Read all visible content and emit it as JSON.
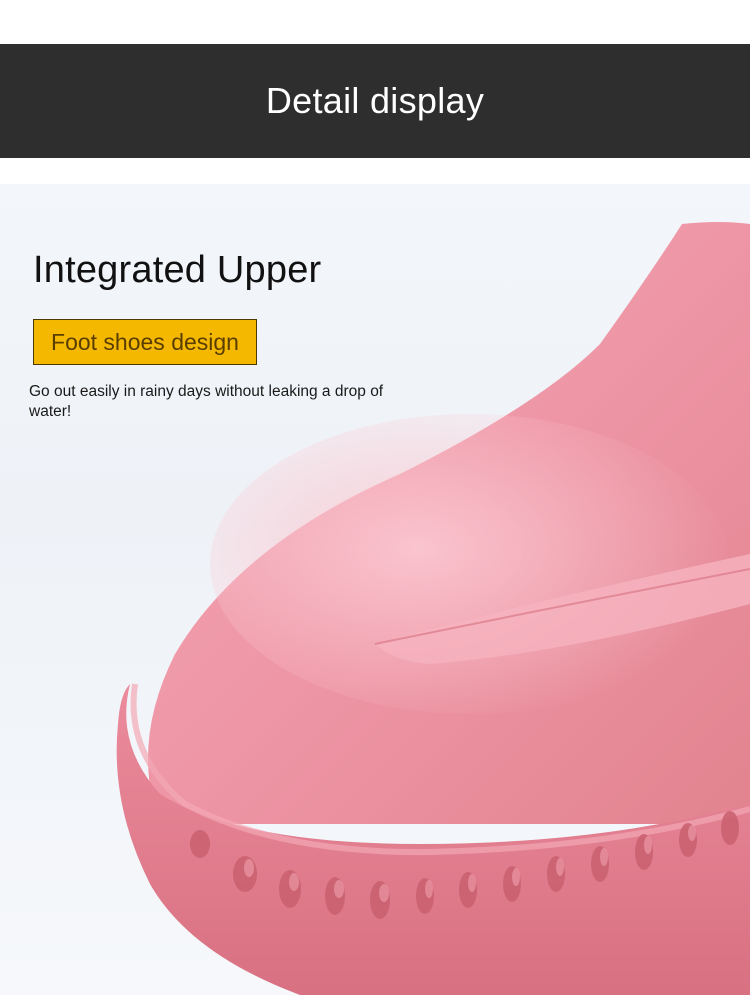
{
  "header": {
    "title": "Detail display"
  },
  "feature": {
    "title": "Integrated Upper",
    "badge_label": "Foot shoes design",
    "description": "Go out easily in rainy days without leaking a drop of water!"
  },
  "colors": {
    "header_background": "#2e2e2e",
    "badge_background": "#f5b800",
    "shoe_pink": "#e8879a"
  },
  "image": {
    "subject": "shoe-photo"
  }
}
